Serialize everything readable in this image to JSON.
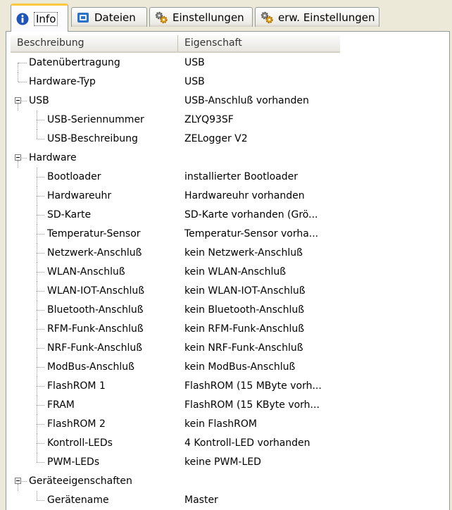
{
  "tabs": [
    {
      "label": "Info",
      "icon": "info-icon"
    },
    {
      "label": "Dateien",
      "icon": "files-icon"
    },
    {
      "label": "Einstellungen",
      "icon": "gears-icon"
    },
    {
      "label": "erw. Einstellungen",
      "icon": "gears-icon"
    }
  ],
  "header": {
    "col1": "Beschreibung",
    "col2": "Eigenschaft"
  },
  "rows": [
    {
      "level": 0,
      "expander": false,
      "desc": "Datenübertragung",
      "val": "USB"
    },
    {
      "level": 0,
      "expander": false,
      "desc": "Hardware-Typ",
      "val": "USB"
    },
    {
      "level": 0,
      "expander": true,
      "desc": "USB",
      "val": "USB-Anschluß vorhanden"
    },
    {
      "level": 1,
      "expander": false,
      "desc": "USB-Seriennummer",
      "val": "ZLYQ93SF"
    },
    {
      "level": 1,
      "expander": false,
      "desc": "USB-Beschreibung",
      "val": "ZELogger V2"
    },
    {
      "level": 0,
      "expander": true,
      "desc": "Hardware",
      "val": ""
    },
    {
      "level": 1,
      "expander": false,
      "desc": "Bootloader",
      "val": "installierter Bootloader"
    },
    {
      "level": 1,
      "expander": false,
      "desc": "Hardwareuhr",
      "val": "Hardwareuhr vorhanden"
    },
    {
      "level": 1,
      "expander": false,
      "desc": "SD-Karte",
      "val": "SD-Karte vorhanden (Grö..."
    },
    {
      "level": 1,
      "expander": false,
      "desc": "Temperatur-Sensor",
      "val": "Temperatur-Sensor vorha..."
    },
    {
      "level": 1,
      "expander": false,
      "desc": "Netzwerk-Anschluß",
      "val": "kein Netzwerk-Anschluß"
    },
    {
      "level": 1,
      "expander": false,
      "desc": "WLAN-Anschluß",
      "val": "kein WLAN-Anschluß"
    },
    {
      "level": 1,
      "expander": false,
      "desc": "WLAN-IOT-Anschluß",
      "val": "kein WLAN-IOT-Anschluß"
    },
    {
      "level": 1,
      "expander": false,
      "desc": "Bluetooth-Anschluß",
      "val": "kein Bluetooth-Anschluß"
    },
    {
      "level": 1,
      "expander": false,
      "desc": "RFM-Funk-Anschluß",
      "val": "kein RFM-Funk-Anschluß"
    },
    {
      "level": 1,
      "expander": false,
      "desc": "NRF-Funk-Anschluß",
      "val": "kein NRF-Funk-Anschluß"
    },
    {
      "level": 1,
      "expander": false,
      "desc": "ModBus-Anschluß",
      "val": "kein ModBus-Anschluß"
    },
    {
      "level": 1,
      "expander": false,
      "desc": "FlashROM 1",
      "val": "FlashROM (15 MByte vorh..."
    },
    {
      "level": 1,
      "expander": false,
      "desc": "FRAM",
      "val": "FlashROM (15 KByte vorh..."
    },
    {
      "level": 1,
      "expander": false,
      "desc": "FlashROM 2",
      "val": "kein FlashROM"
    },
    {
      "level": 1,
      "expander": false,
      "desc": "Kontroll-LEDs",
      "val": "4 Kontroll-LED vorhanden"
    },
    {
      "level": 1,
      "expander": false,
      "desc": "PWM-LEDs",
      "val": "keine PWM-LED"
    },
    {
      "level": 0,
      "expander": true,
      "desc": "Geräteeigenschaften",
      "val": ""
    },
    {
      "level": 1,
      "expander": false,
      "desc": "Gerätename",
      "val": "Master"
    }
  ]
}
